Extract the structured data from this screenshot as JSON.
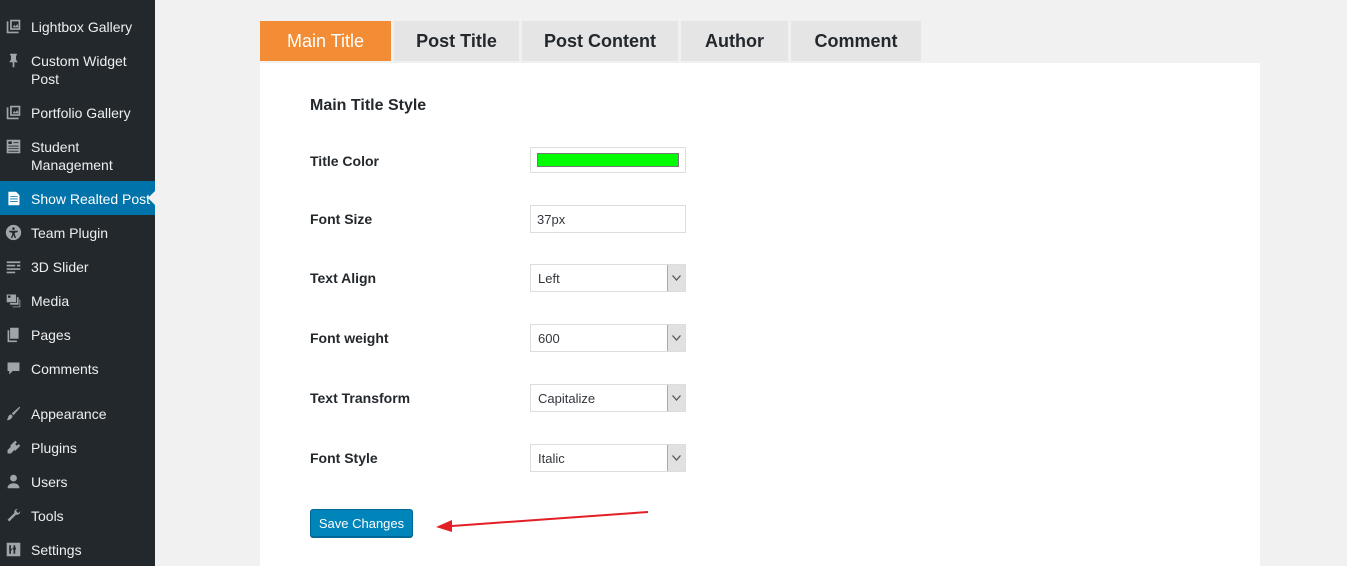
{
  "sidebar": {
    "items": [
      {
        "label": "Lightbox Gallery",
        "icon": "gallery-icon"
      },
      {
        "label": "Custom Widget Post",
        "icon": "pin-icon"
      },
      {
        "label": "Portfolio Gallery",
        "icon": "gallery-icon"
      },
      {
        "label": "Student Management",
        "icon": "id-card-icon"
      },
      {
        "label": "Show Realted Post",
        "icon": "page-icon"
      },
      {
        "label": "Team Plugin",
        "icon": "universal-access-icon"
      },
      {
        "label": "3D Slider",
        "icon": "list-icon"
      },
      {
        "label": "Media",
        "icon": "media-icon"
      },
      {
        "label": "Pages",
        "icon": "pages-icon"
      },
      {
        "label": "Comments",
        "icon": "comment-icon"
      },
      {
        "label": "Appearance",
        "icon": "paintbrush-icon"
      },
      {
        "label": "Plugins",
        "icon": "plug-icon"
      },
      {
        "label": "Users",
        "icon": "user-icon"
      },
      {
        "label": "Tools",
        "icon": "wrench-icon"
      },
      {
        "label": "Settings",
        "icon": "settings-icon"
      }
    ],
    "active": "Show Realted Post"
  },
  "tabs": [
    {
      "label": "Main Title",
      "active": true
    },
    {
      "label": "Post Title",
      "active": false
    },
    {
      "label": "Post Content",
      "active": false
    },
    {
      "label": "Author",
      "active": false
    },
    {
      "label": "Comment",
      "active": false
    }
  ],
  "form": {
    "section_title": "Main Title Style",
    "title_color_label": "Title Color",
    "title_color_value": "#00ff00",
    "font_size_label": "Font Size",
    "font_size_value": "37px",
    "text_align_label": "Text Align",
    "text_align_value": "Left",
    "font_weight_label": "Font weight",
    "font_weight_value": "600",
    "text_transform_label": "Text Transform",
    "text_transform_value": "Capitalize",
    "font_style_label": "Font Style",
    "font_style_value": "Italic",
    "save_label": "Save Changes"
  },
  "colors": {
    "accent_tab": "#f38d35",
    "sidebar_bg": "#23282d",
    "sidebar_active": "#0073aa",
    "button_primary": "#0085ba",
    "annotation_arrow": "#e31e24"
  }
}
